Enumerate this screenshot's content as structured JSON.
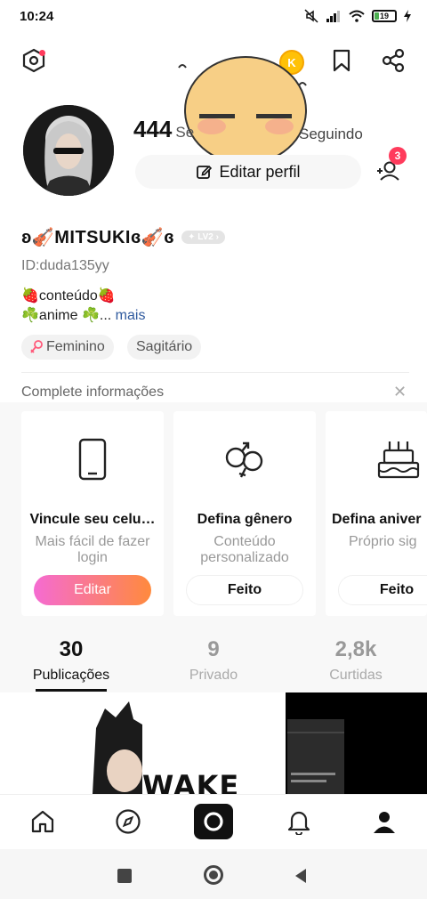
{
  "status": {
    "time": "10:24",
    "battery": "19",
    "battery_level": 0.19
  },
  "top": {
    "coin_label": "K"
  },
  "profile": {
    "stat_count": "444",
    "stat_label": "Se",
    "seguindo_label": "Seguindo",
    "edit_label": "Editar perfil",
    "notif_count": "3",
    "username": "ʚ🎻MITSUKIɞ🎻ɞ",
    "level": "LV2",
    "id": "ID:duda135yy",
    "bio_line1": "🍓conteúdo🍓",
    "bio_line2": "☘️anime ☘️...",
    "bio_more": "mais",
    "tags": [
      "Feminino",
      "Sagitário"
    ]
  },
  "complete": {
    "title": "Complete informações",
    "cards": [
      {
        "title": "Vincule seu celu…",
        "sub": "Mais fácil de fazer login",
        "button": "Editar",
        "icon": "phone-icon"
      },
      {
        "title": "Defina gênero",
        "sub": "Conteúdo personalizado",
        "button": "Feito",
        "icon": "gender-icon"
      },
      {
        "title": "Defina aniver",
        "sub": "Próprio sig",
        "button": "Feito",
        "icon": "cake-icon"
      }
    ]
  },
  "tabs": [
    {
      "count": "30",
      "label": "Publicações"
    },
    {
      "count": "9",
      "label": "Privado"
    },
    {
      "count": "2,8k",
      "label": "Curtidas"
    }
  ],
  "thumbs": {
    "wake_text": "WAKE UP"
  },
  "colors": {
    "accent": "#ff3b5c",
    "gradient_start": "#f56bd2",
    "gradient_end": "#ff8a3d"
  }
}
